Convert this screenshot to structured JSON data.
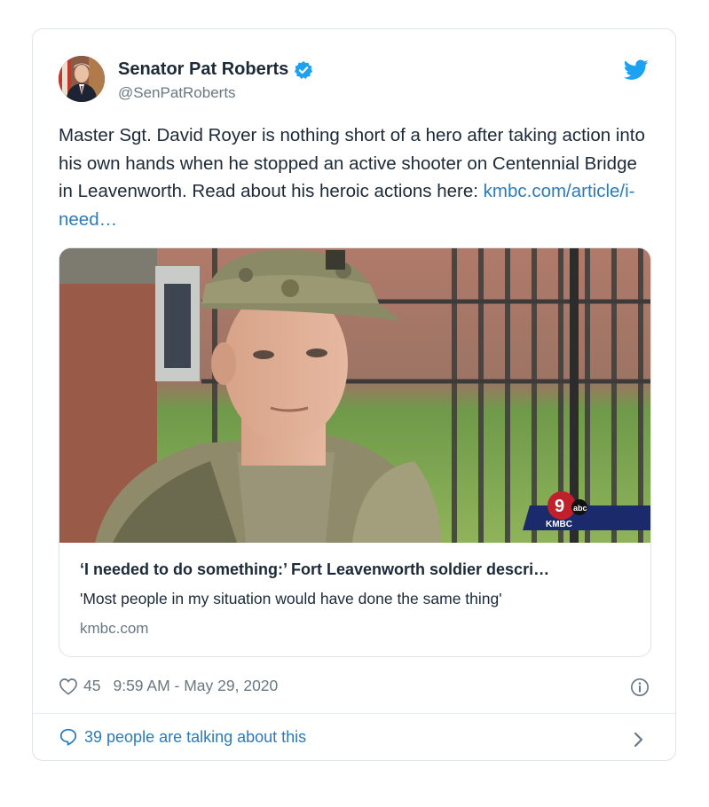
{
  "tweet": {
    "author_name": "Senator Pat Roberts",
    "handle": "@SenPatRoberts",
    "text": "Master Sgt. David Royer is nothing short of a hero after taking action into his own hands when he stopped an active shooter on Centennial Bridge in Leavenworth. Read about his heroic actions here: ",
    "link_text": "kmbc.com/article/i-need…",
    "likes": "45",
    "timestamp": "9:59 AM - May 29, 2020",
    "conversation": "39 people are talking about this"
  },
  "link_card": {
    "title": "‘I needed to do something:’ Fort Leavenworth soldier descri…",
    "description": "'Most people in my situation would have done the same thing'",
    "domain": "kmbc.com",
    "station_logo_text": "KMBC"
  },
  "colors": {
    "link": "#2b7bb9",
    "muted": "#697882",
    "text": "#1c2938",
    "twitter_blue": "#1da1f2"
  },
  "icons": [
    "verified-badge-icon",
    "twitter-bird-icon",
    "heart-icon",
    "info-icon",
    "chat-bubble-icon",
    "chevron-right-icon"
  ]
}
